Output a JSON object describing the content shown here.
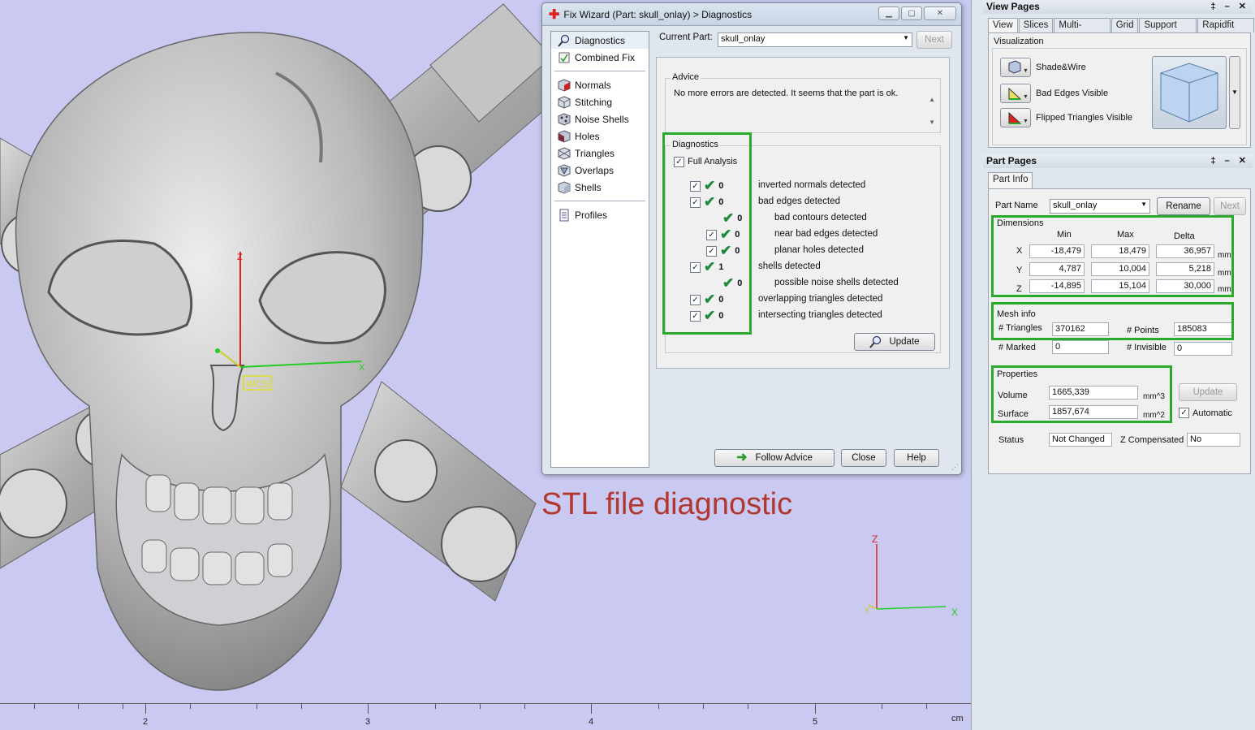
{
  "caption": "STL file diagnostic",
  "ruler": {
    "ticks": [
      "2",
      "3",
      "4",
      "5"
    ],
    "unit": "cm"
  },
  "viewport": {
    "wcs_label": "WCS",
    "axis_x": "X",
    "axis_y": "Y",
    "axis_z": "Z"
  },
  "colors": {
    "highlight": "#2aaa2a",
    "caption": "#b1372f",
    "viewport_bg": "#c9c9f1",
    "check": "#1d8a3b"
  },
  "fix_wizard": {
    "title": "Fix Wizard (Part: skull_onlay) > Diagnostics",
    "nav": [
      {
        "label": "Diagnostics",
        "icon": "magnifier-icon"
      },
      {
        "label": "Combined Fix",
        "icon": "combined-fix-icon"
      },
      {
        "label": "Normals",
        "icon": "normals-cube-icon"
      },
      {
        "label": "Stitching",
        "icon": "stitching-cube-icon"
      },
      {
        "label": "Noise Shells",
        "icon": "noise-shells-icon"
      },
      {
        "label": "Holes",
        "icon": "holes-cube-icon"
      },
      {
        "label": "Triangles",
        "icon": "triangles-cube-icon"
      },
      {
        "label": "Overlaps",
        "icon": "overlaps-cube-icon"
      },
      {
        "label": "Shells",
        "icon": "shells-cube-icon"
      },
      {
        "label": "Profiles",
        "icon": "document-icon"
      }
    ],
    "current_part_label": "Current Part:",
    "current_part_value": "skull_onlay",
    "next_label": "Next",
    "advice_title": "Advice",
    "advice_text": "No more errors are detected. It seems that the part is ok.",
    "diagnostics_title": "Diagnostics",
    "full_analysis_label": "Full Analysis",
    "rows": [
      {
        "count": "0",
        "label": "inverted normals detected"
      },
      {
        "count": "0",
        "label": "bad edges detected"
      },
      {
        "count": "0",
        "label": "bad contours detected"
      },
      {
        "count": "0",
        "label": "near bad edges detected"
      },
      {
        "count": "0",
        "label": "planar holes detected"
      },
      {
        "count": "1",
        "label": "shells detected"
      },
      {
        "count": "0",
        "label": "possible noise shells detected"
      },
      {
        "count": "0",
        "label": "overlapping triangles detected"
      },
      {
        "count": "0",
        "label": "intersecting triangles detected"
      }
    ],
    "update_label": "Update",
    "follow_advice_label": "Follow Advice",
    "close_label": "Close",
    "help_label": "Help"
  },
  "view_pages": {
    "title": "View Pages",
    "tabs": [
      "View",
      "Slices",
      "Multi-Section",
      "Grid",
      "Support View",
      "Rapidfit View"
    ],
    "visualization_title": "Visualization",
    "items": [
      "Shade&Wire",
      "Bad Edges Visible",
      "Flipped Triangles Visible"
    ]
  },
  "part_pages": {
    "title": "Part Pages",
    "tab": "Part Info",
    "part_name_label": "Part Name",
    "part_name_value": "skull_onlay",
    "rename_label": "Rename",
    "next_label": "Next",
    "dimensions_title": "Dimensions",
    "col_min": "Min",
    "col_max": "Max",
    "col_delta": "Delta",
    "rows": [
      {
        "axis": "X",
        "min": "-18,479",
        "max": "18,479",
        "delta": "36,957",
        "unit": "mm"
      },
      {
        "axis": "Y",
        "min": "4,787",
        "max": "10,004",
        "delta": "5,218",
        "unit": "mm"
      },
      {
        "axis": "Z",
        "min": "-14,895",
        "max": "15,104",
        "delta": "30,000",
        "unit": "mm"
      }
    ],
    "mesh_title": "Mesh info",
    "triangles_label": "# Triangles",
    "triangles_value": "370162",
    "points_label": "# Points",
    "points_value": "185083",
    "marked_label": "# Marked",
    "marked_value": "0",
    "invisible_label": "# Invisible",
    "invisible_value": "0",
    "properties_title": "Properties",
    "volume_label": "Volume",
    "volume_value": "1665,339",
    "volume_unit": "mm^3",
    "surface_label": "Surface",
    "surface_value": "1857,674",
    "surface_unit": "mm^2",
    "update_label": "Update",
    "automatic_label": "Automatic",
    "status_label": "Status",
    "status_value": "Not Changed",
    "zcomp_label": "Z Compensated",
    "zcomp_value": "No"
  }
}
